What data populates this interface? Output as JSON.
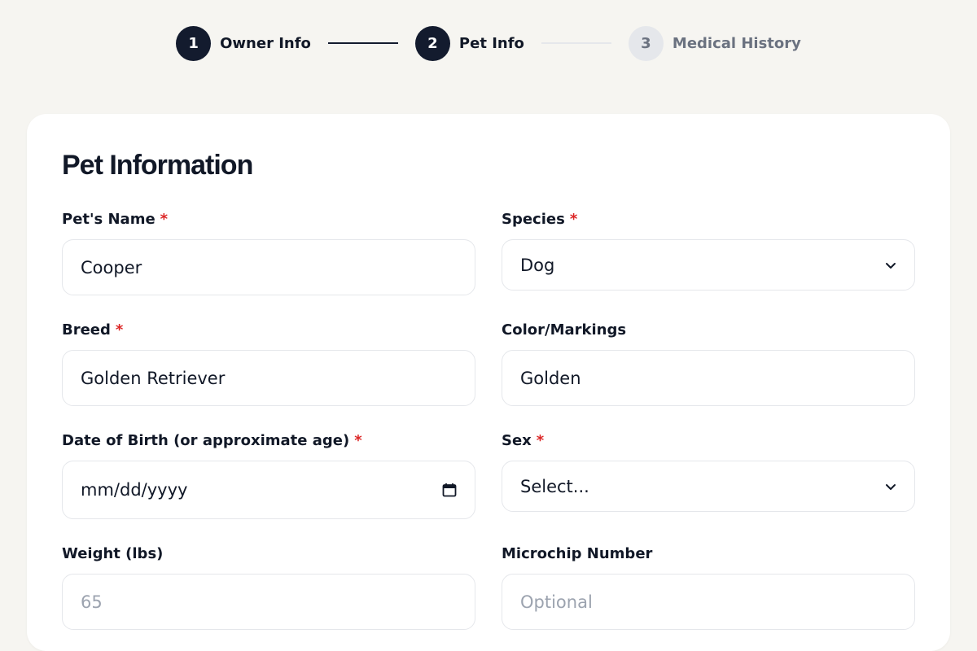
{
  "steps": [
    {
      "number": "1",
      "label": "Owner Info",
      "state": "complete"
    },
    {
      "number": "2",
      "label": "Pet Info",
      "state": "active"
    },
    {
      "number": "3",
      "label": "Medical History",
      "state": "upcoming"
    }
  ],
  "form": {
    "title": "Pet Information",
    "required_marker": "*",
    "pet_name": {
      "label": "Pet's Name",
      "value": "Cooper"
    },
    "species": {
      "label": "Species",
      "selected": "Dog"
    },
    "breed": {
      "label": "Breed",
      "value": "Golden Retriever"
    },
    "color": {
      "label": "Color/Markings",
      "value": "Golden"
    },
    "dob": {
      "label": "Date of Birth (or approximate age)",
      "placeholder": "mm/dd/yyyy"
    },
    "sex": {
      "label": "Sex",
      "selected": "Select..."
    },
    "weight": {
      "label": "Weight (lbs)",
      "placeholder": "65"
    },
    "microchip": {
      "label": "Microchip Number",
      "placeholder": "Optional"
    }
  },
  "colors": {
    "accent": "#131b2e",
    "required": "#dc2626",
    "inactive_step": "#e5e7eb",
    "background": "#f6f5f1"
  },
  "icons": {
    "select": "chevron-down-icon",
    "date": "calendar-icon"
  }
}
